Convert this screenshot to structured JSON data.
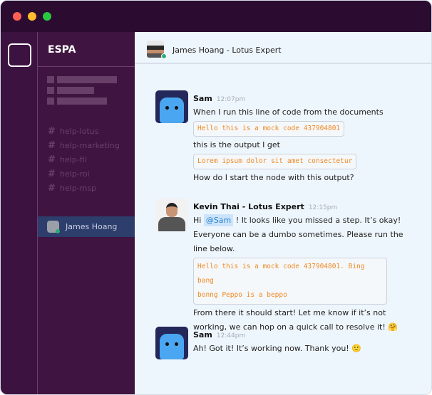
{
  "window": {
    "controls": {
      "close": "#ff5f57",
      "minimize": "#febc2e",
      "maximize": "#28c840"
    }
  },
  "sidebar": {
    "team": "ESPA",
    "channels": [
      "help-lotus",
      "help-marketing",
      "help-fil",
      "help-roi",
      "help-msp"
    ],
    "channel_prefix": "#",
    "dm": {
      "name": "James Hoang"
    }
  },
  "header": {
    "title": "James Hoang - Lotus Expert"
  },
  "messages": [
    {
      "author": "Sam",
      "time": "12:07pm",
      "line1": "When I run this line of code from the documents",
      "code1": "Hello this is a mock code 437904801",
      "line2": "this is the output I get",
      "code2": "Lorem ipsum dolor sit amet consectetur",
      "line3": "How do I start the node with this output?"
    },
    {
      "author": "Kevin Thai - Lotus Expert",
      "time": "12:15pm",
      "hi": "Hi",
      "mention": "@Sam",
      "text1": "! It looks like you missed a step. It’s okay!",
      "text2": "Everyone can be a dumbo sometimes. Please run the",
      "text3": "line below.",
      "code_a": "Hello this is a mock code 437904801. Bing bang",
      "code_b": "bonng Peppo is a beppo",
      "text4": "From there it should start! Let me know if it’s not",
      "text5": "working, we can hop on a quick call to resolve it!",
      "emoji": "🤗"
    },
    {
      "author": "Sam",
      "time": "12:44pm",
      "text": "Ah! Got it! It’s working now. Thank you!",
      "emoji": "🙂"
    }
  ]
}
